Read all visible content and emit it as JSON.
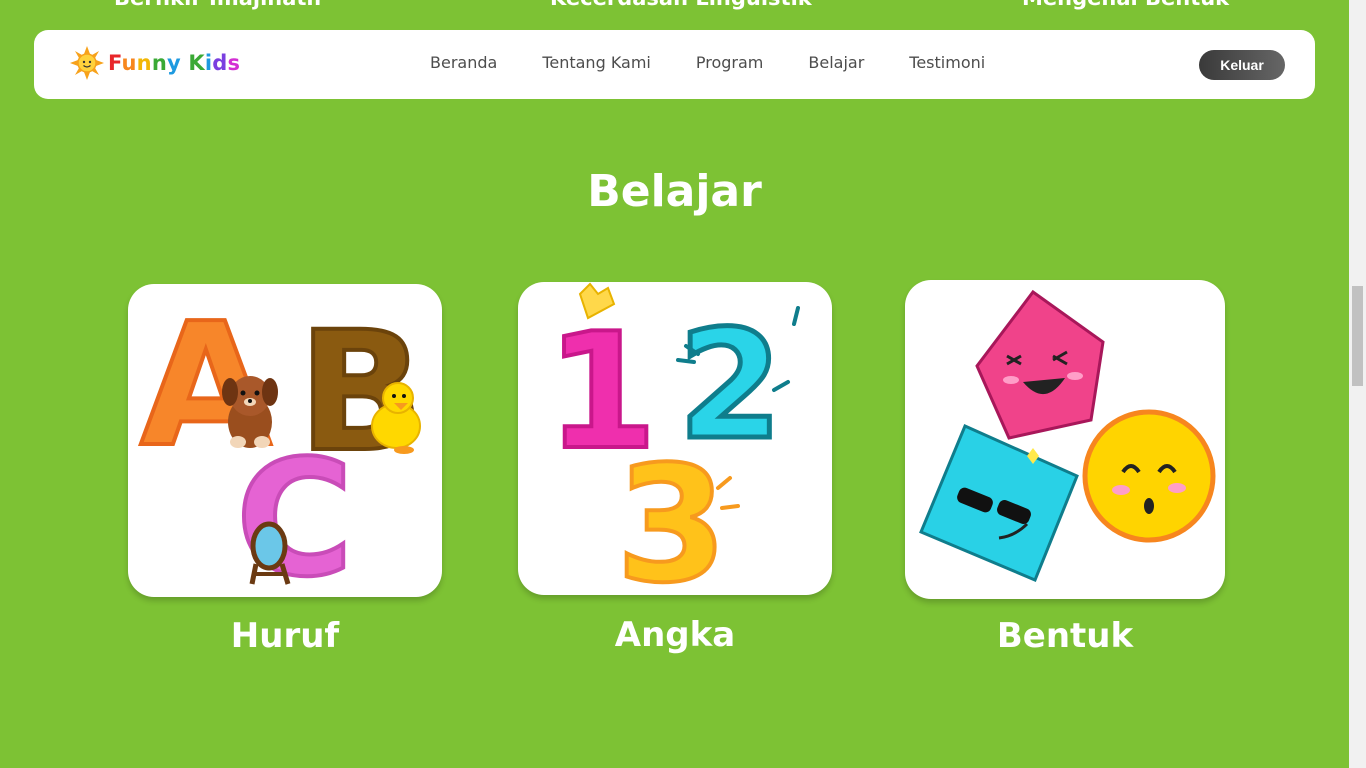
{
  "top_cutoff": [
    "Berfikir Imajinatif",
    "Kecerdasan Linguistik",
    "Mengenal Bentuk"
  ],
  "logo": {
    "funny": "Funny",
    "kids": "Kids"
  },
  "nav": {
    "links": [
      "Beranda",
      "Tentang Kami",
      "Program",
      "Belajar",
      "Testimoni"
    ],
    "logout": "Keluar"
  },
  "section": {
    "title": "Belajar"
  },
  "cards": [
    {
      "label": "Huruf",
      "letters": [
        "A",
        "B",
        "C"
      ]
    },
    {
      "label": "Angka",
      "digits": [
        "1",
        "2",
        "3"
      ]
    },
    {
      "label": "Bentuk"
    }
  ],
  "colors": {
    "background": "#7dc234",
    "nav_bg": "#ffffff",
    "title": "#ffffff"
  }
}
